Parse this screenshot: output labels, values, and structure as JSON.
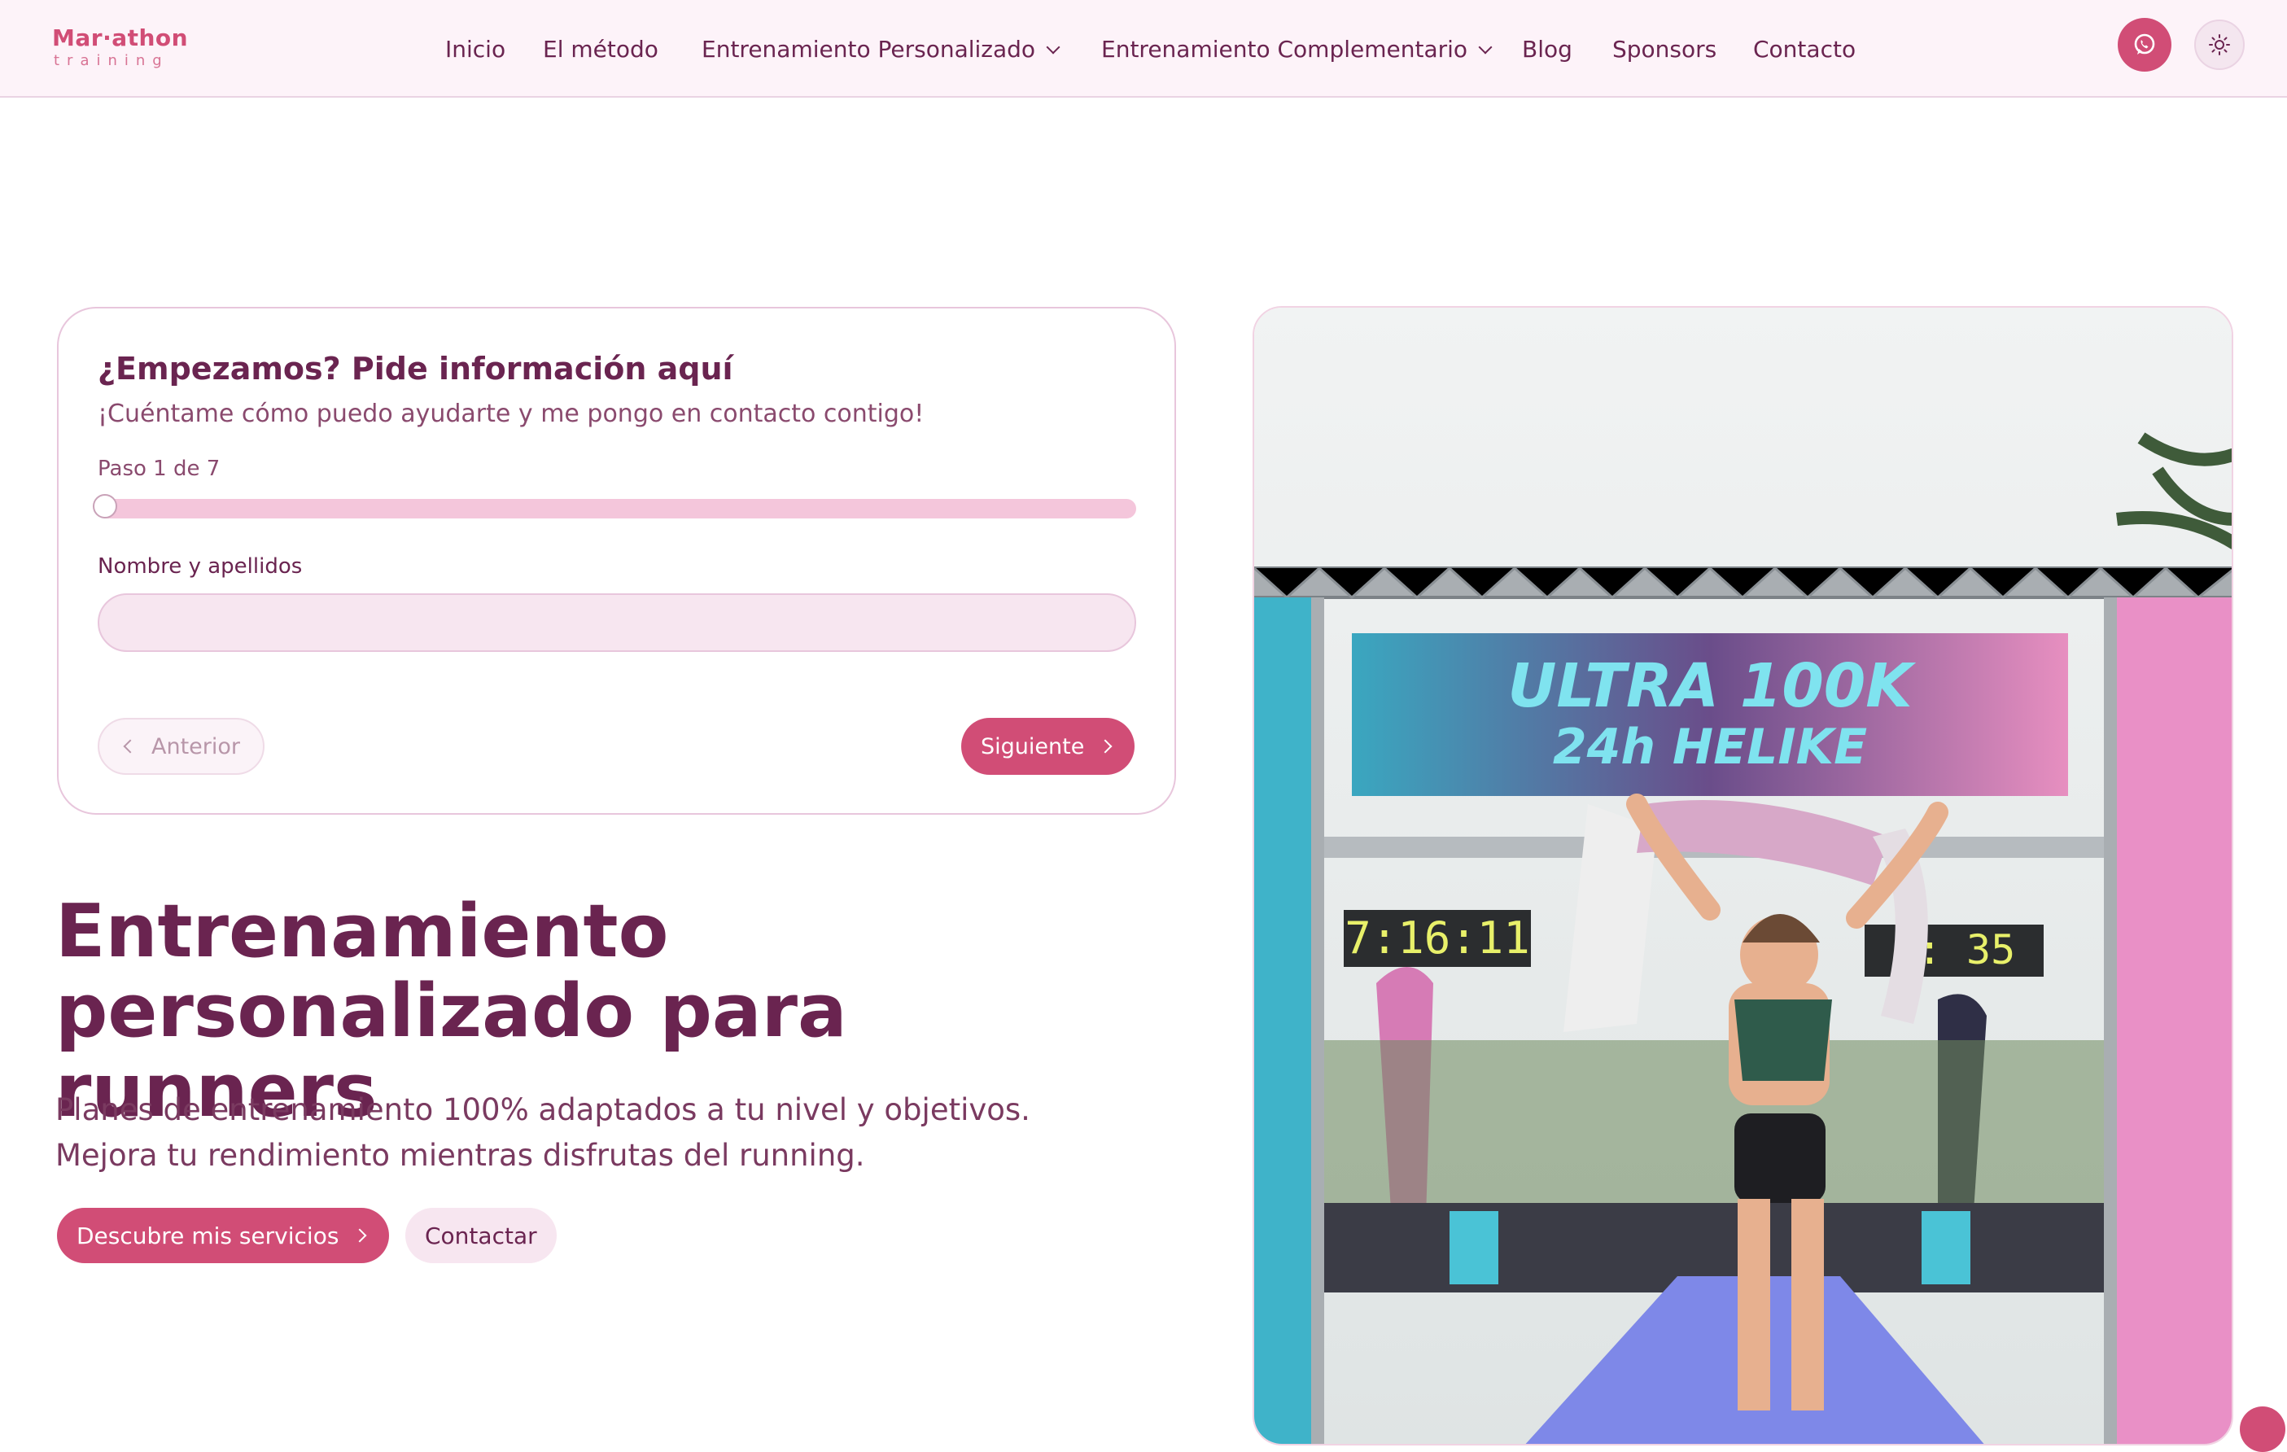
{
  "header": {
    "logo_main": "Mar·athon",
    "logo_sub": "training",
    "nav": {
      "inicio": "Inicio",
      "metodo": "El método",
      "personalizado": "Entrenamiento Personalizado",
      "complementario": "Entrenamiento Complementario",
      "blog": "Blog",
      "sponsors": "Sponsors",
      "contacto": "Contacto"
    },
    "icons": {
      "whatsapp": "whatsapp-icon",
      "theme": "sun-icon"
    }
  },
  "form": {
    "title": "¿Empezamos? Pide información aquí",
    "subtitle": "¡Cuéntame cómo puedo ayudarte y me pongo en contacto contigo!",
    "step_label": "Paso 1 de 7",
    "progress": 0,
    "name_label": "Nombre y apellidos",
    "name_value": "",
    "prev_label": "Anterior",
    "next_label": "Siguiente"
  },
  "hero": {
    "title_line1": "Entrenamiento",
    "title_line2": "personalizado para runners",
    "desc_line1": "Planes de entrenamiento 100% adaptados a tu nivel y objetivos.",
    "desc_line2": "Mejora tu rendimiento mientras disfrutas del running.",
    "services_label": "Descubre mis servicios",
    "contact_label": "Contactar"
  },
  "photo": {
    "banner_text": "ULTRA 100K 24h HELIKE",
    "clock_left": "7:16:11",
    "clock_right": "5:  35"
  },
  "colors": {
    "accent": "#d14d76",
    "text": "#6a2450",
    "header_bg": "#fdf3f9"
  }
}
